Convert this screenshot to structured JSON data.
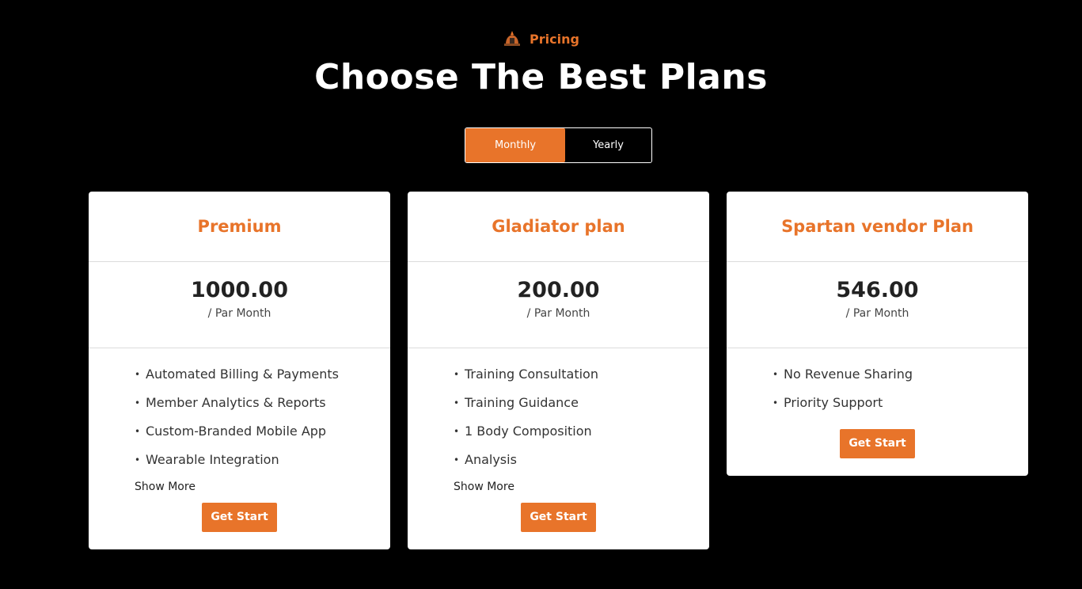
{
  "header": {
    "eyebrow": "Pricing",
    "eyebrow_icon": "spartan-helmet-icon",
    "title": "Choose The Best Plans"
  },
  "billing_toggle": {
    "options": [
      "Monthly",
      "Yearly"
    ],
    "selected": "Monthly"
  },
  "colors": {
    "accent": "#e8742a",
    "background": "#000000",
    "card": "#ffffff"
  },
  "plans": [
    {
      "name": "Premium",
      "price": "1000.00",
      "period": "/ Par Month",
      "features": [
        "Automated Billing & Payments",
        "Member Analytics & Reports",
        "Custom-Branded Mobile App",
        "Wearable Integration"
      ],
      "show_more": "Show More",
      "cta": "Get Start"
    },
    {
      "name": "Gladiator plan",
      "price": "200.00",
      "period": "/ Par Month",
      "features": [
        "Training Consultation",
        "Training Guidance",
        "1 Body Composition",
        "Analysis"
      ],
      "show_more": "Show More",
      "cta": "Get Start"
    },
    {
      "name": "Spartan vendor Plan",
      "price": "546.00",
      "period": "/ Par Month",
      "features": [
        "No Revenue Sharing",
        "Priority Support"
      ],
      "cta": "Get Start"
    }
  ]
}
